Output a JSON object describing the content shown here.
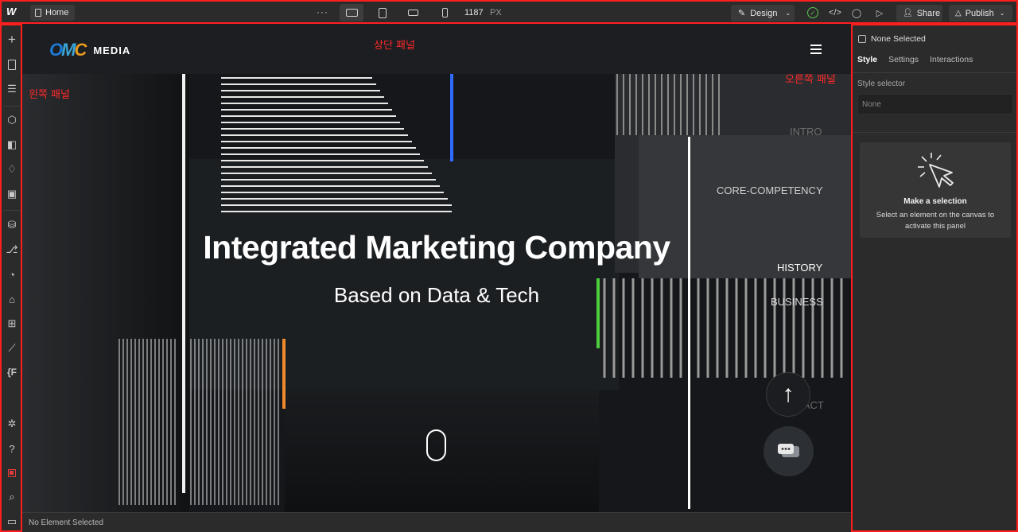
{
  "topbar": {
    "page_name": "Home",
    "more_label": "···",
    "width_value": "1187",
    "width_unit": "PX",
    "mode_label": "Design",
    "share_label": "Share",
    "publish_label": "Publish"
  },
  "annotations": {
    "top_panel": "상단 패널",
    "left_panel": "왼쪽 패널",
    "right_panel": "오른쪽 패널"
  },
  "left_panel": {
    "icons": [
      "add-icon",
      "pages-icon",
      "navigator-icon",
      "components-icon",
      "styles-icon",
      "variables-icon",
      "assets-icon",
      "cms-icon",
      "logic-icon",
      "users-icon",
      "ecommerce-icon",
      "apps-icon",
      "analytics-icon",
      "code-f-icon",
      "settings-icon",
      "help-icon",
      "record-icon",
      "search-icon",
      "video-icon"
    ]
  },
  "canvas": {
    "brand_name": "MEDIA",
    "hero_title": "Integrated Marketing Company",
    "hero_subtitle": "Based on Data & Tech",
    "side_nav": [
      "INTRO",
      "CORE-COMPETENCY",
      "HISTORY",
      "BUSINESS",
      "CONTACT"
    ]
  },
  "status": {
    "text": "No Element Selected"
  },
  "right_panel": {
    "selection_label": "None Selected",
    "tabs": [
      "Style",
      "Settings",
      "Interactions"
    ],
    "style_selector_label": "Style selector",
    "style_selector_value": "None",
    "card_title": "Make a selection",
    "card_desc": "Select an element on the canvas to activate this panel"
  },
  "colors": {
    "highlight_border": "#ff1e1e",
    "accent_blue": "#2f6bff",
    "accent_green": "#4ccd3f",
    "accent_orange": "#f08a2c",
    "published_check": "#5cc24f"
  }
}
